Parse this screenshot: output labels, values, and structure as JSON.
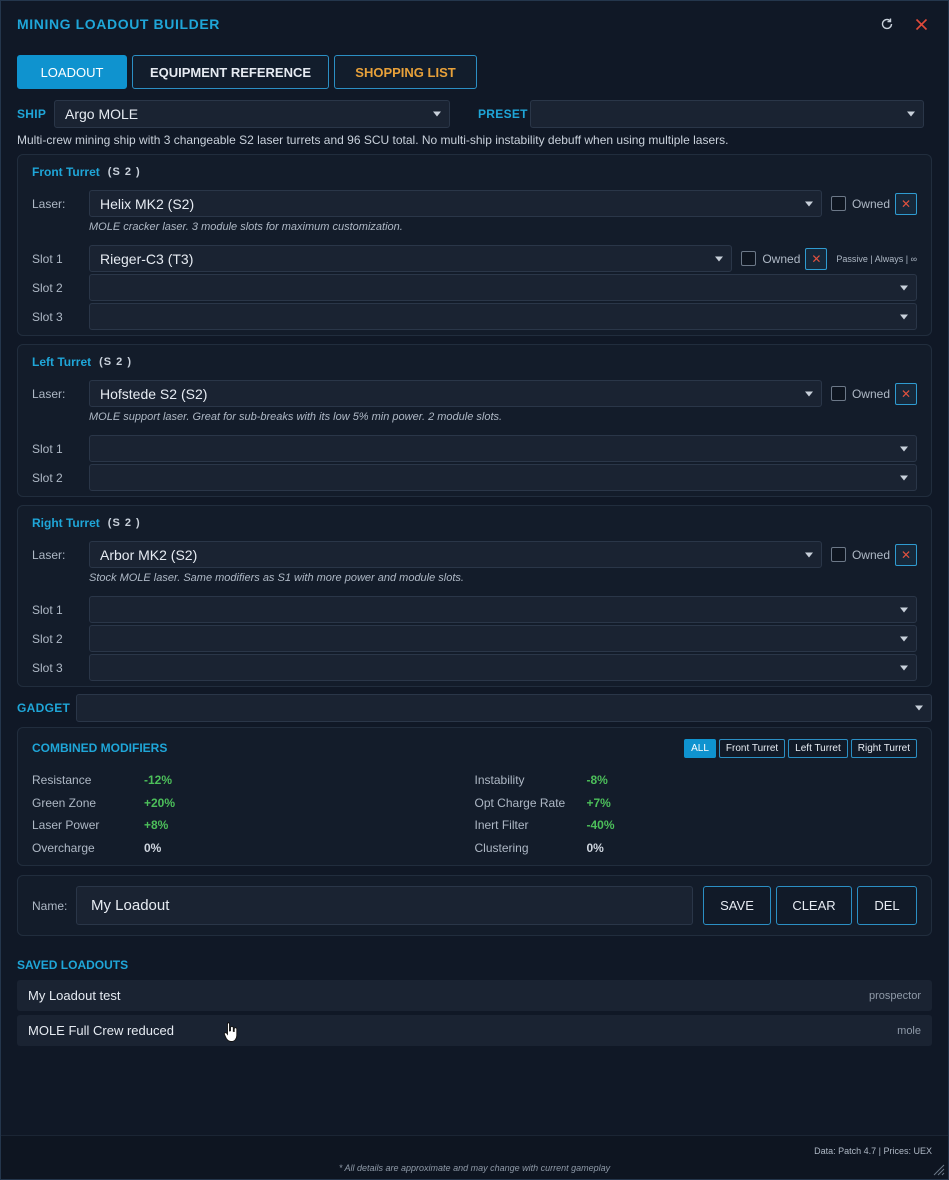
{
  "window": {
    "title": "MINING LOADOUT BUILDER"
  },
  "tabs": [
    {
      "label": "LOADOUT",
      "active": true
    },
    {
      "label": "EQUIPMENT REFERENCE",
      "active": false
    },
    {
      "label": "SHOPPING LIST",
      "active": false
    }
  ],
  "ship": {
    "label": "SHIP",
    "value": "Argo MOLE",
    "preset_label": "PRESET",
    "preset_value": "",
    "description": "Multi-crew mining ship with 3 changeable S2 laser turrets and 96 SCU total. No multi-ship instability debuff when using multiple lasers."
  },
  "common": {
    "owned_label": "Owned",
    "laser_label": "Laser:",
    "remove_glyph": "✕"
  },
  "turrets": [
    {
      "title": "Front Turret",
      "size": "(S 2 )",
      "laser": "Helix MK2 (S2)",
      "laser_desc": "MOLE cracker laser. 3 module slots for maximum customization.",
      "slots": [
        {
          "label": "Slot 1",
          "value": "Rieger-C3 (T3)",
          "info": "Passive | Always | ∞"
        },
        {
          "label": "Slot 2",
          "value": ""
        },
        {
          "label": "Slot 3",
          "value": ""
        }
      ]
    },
    {
      "title": "Left Turret",
      "size": "(S 2 )",
      "laser": "Hofstede S2 (S2)",
      "laser_desc": "MOLE support laser. Great for sub-breaks with its low 5% min power. 2 module slots.",
      "slots": [
        {
          "label": "Slot 1",
          "value": ""
        },
        {
          "label": "Slot 2",
          "value": ""
        }
      ]
    },
    {
      "title": "Right Turret",
      "size": "(S 2 )",
      "laser": "Arbor MK2 (S2)",
      "laser_desc": "Stock MOLE laser. Same modifiers as S1 with more power and module slots.",
      "slots": [
        {
          "label": "Slot 1",
          "value": ""
        },
        {
          "label": "Slot 2",
          "value": ""
        },
        {
          "label": "Slot 3",
          "value": ""
        }
      ]
    }
  ],
  "gadget": {
    "label": "GADGET",
    "value": ""
  },
  "modifiers": {
    "title": "COMBINED MODIFIERS",
    "filters": [
      "ALL",
      "Front Turret",
      "Left Turret",
      "Right Turret"
    ],
    "left": [
      {
        "key": "Resistance",
        "value": "-12%",
        "positive": true
      },
      {
        "key": "Green Zone",
        "value": "+20%",
        "positive": true
      },
      {
        "key": "Laser Power",
        "value": "+8%",
        "positive": true
      },
      {
        "key": "Overcharge",
        "value": "0%",
        "positive": false
      }
    ],
    "right": [
      {
        "key": "Instability",
        "value": "-8%",
        "positive": true
      },
      {
        "key": "Opt Charge Rate",
        "value": "+7%",
        "positive": true
      },
      {
        "key": "Inert Filter",
        "value": "-40%",
        "positive": true
      },
      {
        "key": "Clustering",
        "value": "0%",
        "positive": false
      }
    ]
  },
  "save": {
    "name_label": "Name:",
    "name_value": "My Loadout",
    "save": "SAVE",
    "clear": "CLEAR",
    "del": "DEL"
  },
  "saved": {
    "title": "SAVED LOADOUTS",
    "items": [
      {
        "name": "My Loadout test",
        "ship": "prospector"
      },
      {
        "name": "MOLE Full Crew reduced",
        "ship": "mole"
      }
    ]
  },
  "footer": {
    "source": "Data: Patch 4.7 | Prices: UEX",
    "note": "* All details are approximate and may change with current gameplay"
  },
  "colors": {
    "accent": "#1fa6d8",
    "active_tab": "#0f93cf",
    "shopping": "#e8a13a",
    "positive": "#4cbf5a",
    "remove": "#e0513f"
  }
}
